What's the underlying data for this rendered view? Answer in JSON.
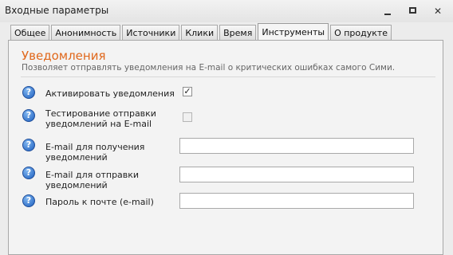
{
  "window": {
    "title": "Входные параметры",
    "minimize_glyph": "",
    "maximize_glyph": "",
    "close_glyph": "✕"
  },
  "tabs": [
    {
      "label": "Общее",
      "active": false
    },
    {
      "label": "Анонимность",
      "active": false
    },
    {
      "label": "Источники",
      "active": false
    },
    {
      "label": "Клики",
      "active": false
    },
    {
      "label": "Время",
      "active": false
    },
    {
      "label": "Инструменты",
      "active": true
    },
    {
      "label": "О продукте",
      "active": false
    }
  ],
  "section": {
    "title": "Уведомления",
    "description": "Позволяет отправлять уведомления на E-mail о критических ошибках самого Сими."
  },
  "help_glyph": "?",
  "fields": {
    "activate": {
      "label": "Активировать уведомления",
      "checked": true,
      "check_glyph": "✓"
    },
    "test": {
      "label_line1": "Тестирование отправки",
      "label_line2": "уведомлений на E-mail",
      "checked": false
    },
    "email_receive": {
      "label_line1": "E-mail для получения",
      "label_line2": "уведомлений",
      "value": ""
    },
    "email_send": {
      "label_line1": "E-mail для отправки",
      "label_line2": "уведомлений",
      "value": ""
    },
    "password": {
      "label": "Пароль к почте (e-mail)",
      "value": ""
    }
  }
}
